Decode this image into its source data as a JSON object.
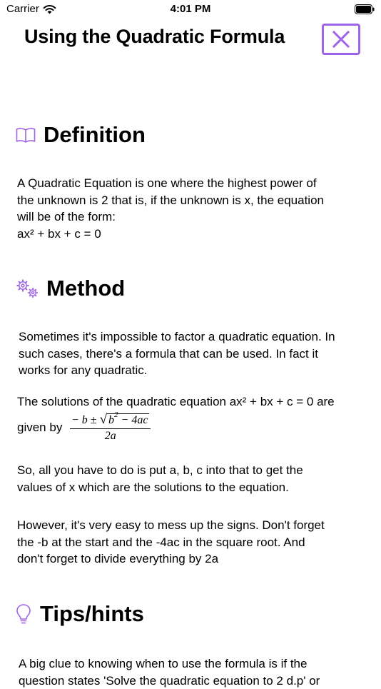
{
  "status_bar": {
    "carrier": "Carrier",
    "time": "4:01 PM"
  },
  "header": {
    "title": "Using the Quadratic Formula",
    "close_icon": "close-x-icon"
  },
  "accent_color": "#a064e8",
  "sections": {
    "definition": {
      "icon": "book-icon",
      "title": "Definition",
      "body": [
        "A Quadratic Equation is one where the highest power of",
        "the unknown is 2 that is, if the unknown is x, the equation",
        "will be of the form:",
        "ax² + bx + c = 0"
      ]
    },
    "method": {
      "icon": "gears-icon",
      "title": "Method",
      "intro": [
        "Sometimes it's impossible to factor a quadratic equation. In",
        "such cases, there's a formula that can be used. In fact it",
        "works for any quadratic."
      ],
      "formula_line1": "The solutions of the quadratic equation ax² + bx + c = 0 are",
      "formula_given_by": "given by",
      "formula": {
        "num_prefix": "− b ± ",
        "radicand": "b",
        "radicand_exp": "2",
        "radicand_rest": " − 4ac",
        "denominator": "2a"
      },
      "para2": [
        "So, all you have to do is put a, b, c into that to get the",
        "values of x which are the solutions to the equation."
      ],
      "para3": [
        "However, it's very easy to mess up the signs. Don't forget",
        "the -b at the start and the -4ac in the square root. And",
        "don't forget to divide everything by 2a"
      ]
    },
    "tips": {
      "icon": "lightbulb-icon",
      "title": "Tips/hints",
      "body": [
        "A big clue to knowing when to use the formula is if the",
        "question states 'Solve the quadratic equation to 2 d.p' or"
      ]
    }
  }
}
